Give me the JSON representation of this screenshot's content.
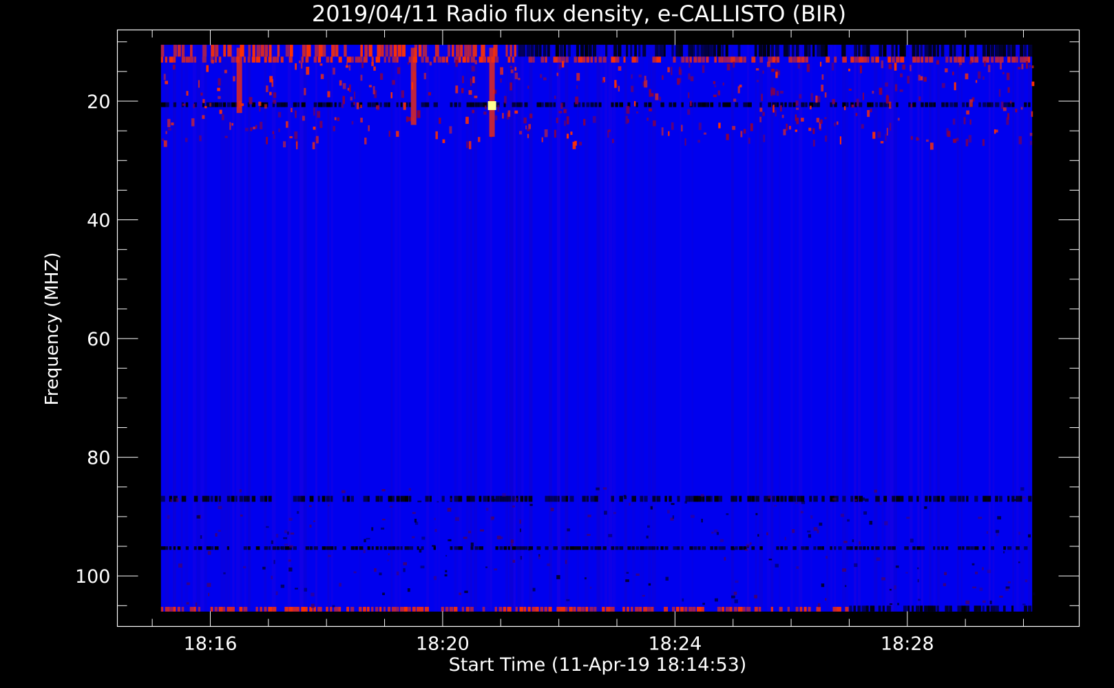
{
  "chart_data": {
    "type": "heatmap",
    "title": "2019/04/11  Radio flux density, e-CALLISTO (BIR)",
    "xlabel": "Start Time (11-Apr-19 18:14:53)",
    "ylabel": "Frequency (MHZ)",
    "x_axis": {
      "start": "18:14:53",
      "ticks": [
        "18:16",
        "18:20",
        "18:24",
        "18:28"
      ],
      "xlim_minutes": [
        14.4,
        30.96
      ],
      "data_range_minutes": [
        15.15,
        30.15
      ],
      "major_tick_minutes": [
        16,
        20,
        24,
        28
      ],
      "minor_step_minutes": 1
    },
    "y_axis": {
      "ticks": [
        "20",
        "40",
        "60",
        "80",
        "100"
      ],
      "major_tick_values": [
        20,
        40,
        60,
        80,
        100
      ],
      "ylim": [
        8,
        108.5
      ],
      "reversed": true,
      "minor_step": 5,
      "data_range": [
        10.5,
        106
      ]
    },
    "grid": false,
    "colors": {
      "background": "#000000",
      "frame": "#ffffff",
      "low": "#0000ee",
      "mid": "#2a00d8",
      "high": "#ff3000",
      "peak": "#ffff90",
      "dropout": "#000000"
    },
    "bands": [
      {
        "freq": [
          10.5,
          12.5
        ],
        "level": "high",
        "time_minutes": [
          15.15,
          21.3
        ]
      },
      {
        "freq": [
          10.5,
          12.5
        ],
        "level": "dropout",
        "time_minutes": [
          21.3,
          30.15
        ]
      },
      {
        "freq": [
          12.5,
          13.5
        ],
        "level": "high",
        "time_minutes": [
          15.15,
          30.15
        ]
      },
      {
        "freq": [
          20.2,
          21.0
        ],
        "level": "dropout",
        "time_minutes": [
          15.15,
          30.15
        ]
      },
      {
        "freq": [
          86.5,
          87.5
        ],
        "level": "dropout",
        "time_minutes": [
          15.15,
          30.15
        ]
      },
      {
        "freq": [
          95.0,
          95.6
        ],
        "level": "dropout",
        "time_minutes": [
          15.15,
          30.15
        ]
      },
      {
        "freq": [
          105.2,
          106.0
        ],
        "level": "high",
        "time_minutes": [
          15.15,
          27.0
        ]
      },
      {
        "freq": [
          105.0,
          106.0
        ],
        "level": "dropout",
        "time_minutes": [
          27.0,
          30.15
        ]
      }
    ],
    "bursts": [
      {
        "time_minutes": 20.85,
        "freq": [
          11,
          26
        ],
        "level": "peak"
      },
      {
        "time_minutes": 19.5,
        "freq": [
          11,
          24
        ],
        "level": "high"
      },
      {
        "time_minutes": 16.5,
        "freq": [
          11,
          22
        ],
        "level": "high"
      }
    ]
  }
}
